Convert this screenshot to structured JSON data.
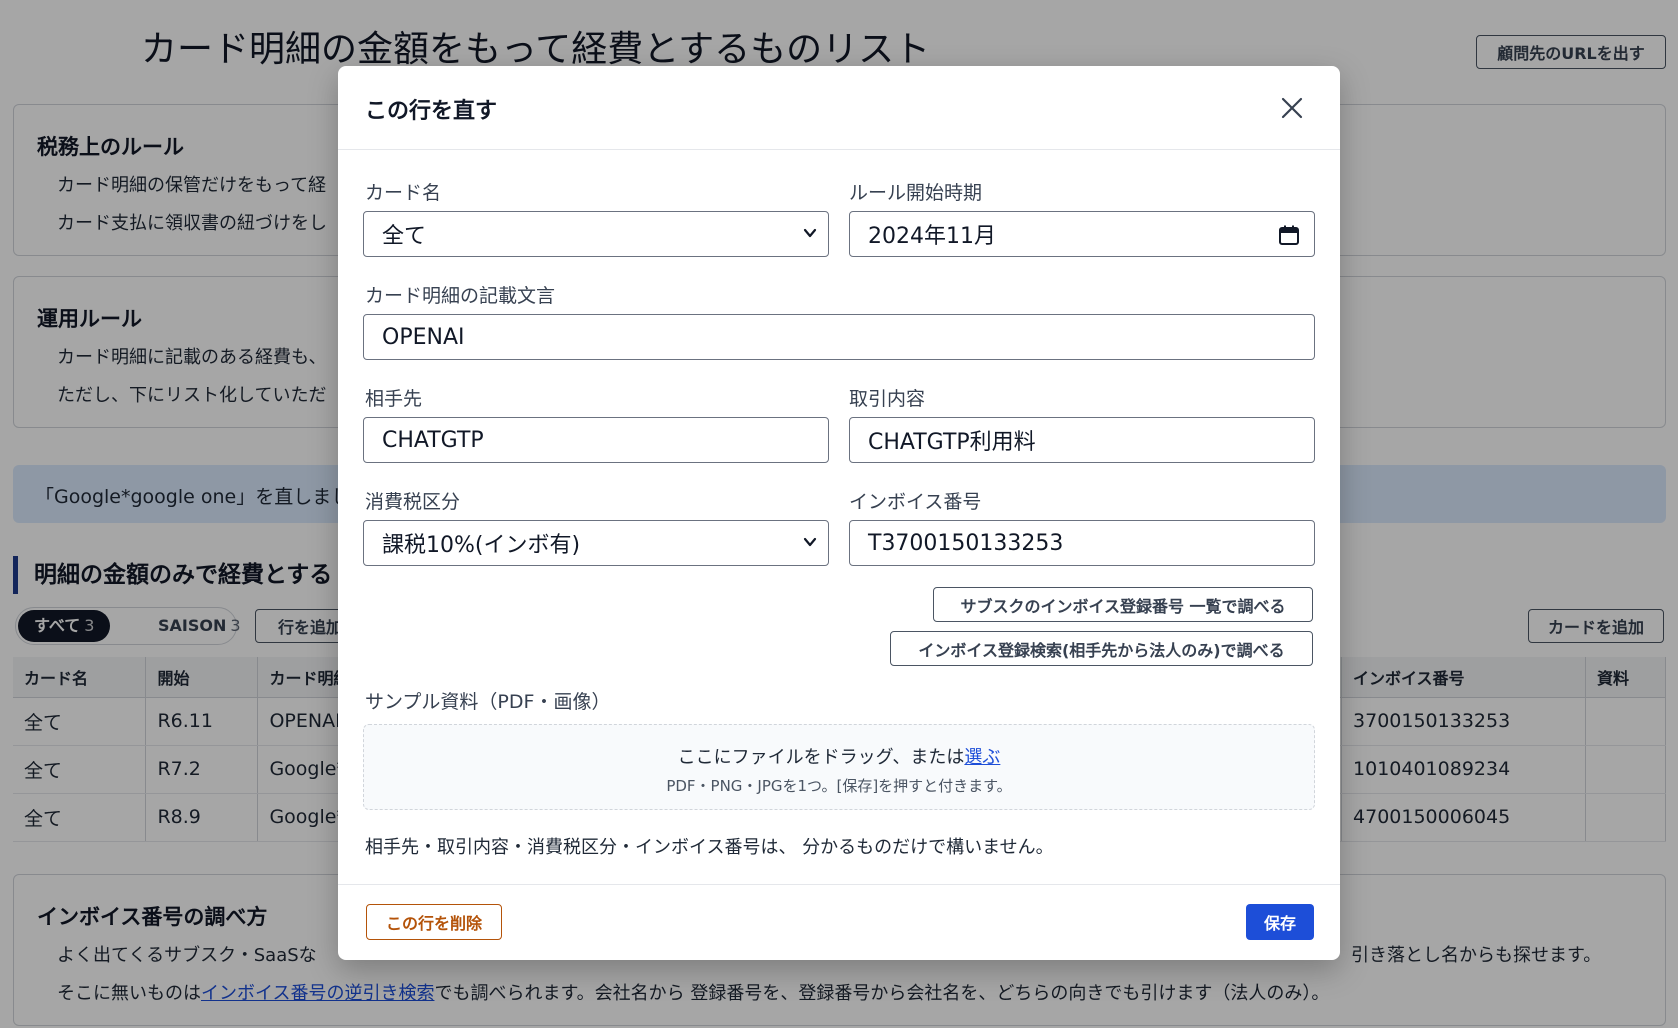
{
  "page": {
    "title": "カード明細の金額をもって経費とするものリスト",
    "share_button": "顧問先のURLを出す"
  },
  "tax_rules": {
    "heading": "税務上のルール",
    "line1": "カード明細の保管だけをもって経",
    "line2": "カード支払に領収書の紐づけをし"
  },
  "operation_rules": {
    "heading": "運用ルール",
    "line1": "カード明細に記載のある経費も、",
    "line2": "ただし、下にリスト化していただ"
  },
  "notice": "「Google*google one」を直しまし",
  "list": {
    "heading": "明細の金額のみで経費とする",
    "filters": [
      {
        "label": "すべて",
        "count": "3"
      },
      {
        "label": "SAISON",
        "count": "3"
      }
    ],
    "add_row_button": "行を追加",
    "add_card_button": "カードを追加",
    "columns": {
      "card": "カード名",
      "start": "開始",
      "text": "カード明細",
      "invoice": "インボイス番号",
      "file": "資料"
    },
    "rows": [
      {
        "card": "全て",
        "start": "R6.11",
        "text": "OPENAI",
        "invoice": "3700150133253",
        "file": ""
      },
      {
        "card": "全て",
        "start": "R7.2",
        "text": "Google*",
        "invoice": "1010401089234",
        "file": ""
      },
      {
        "card": "全て",
        "start": "R8.9",
        "text": "Google*",
        "invoice": "4700150006045",
        "file": ""
      }
    ]
  },
  "lookup": {
    "heading": "インボイス番号の調べ方",
    "line1_start": "よく出てくるサブスク・SaaSな",
    "line1_end": "引き落とし名からも探せます。",
    "line2_pre": "そこに無いものは",
    "line2_link": "インボイス番号の逆引き検索",
    "line2_post": "でも調べられます。会社名から 登録番号を、登録番号から会社名を、どちらの向きでも引けます（法人のみ）。"
  },
  "modal": {
    "title": "この行を直す",
    "card_name_label": "カード名",
    "card_name_value": "全て",
    "start_label": "ルール開始時期",
    "start_value": "2024年11月",
    "statement_label": "カード明細の記載文言",
    "statement_value": "OPENAI",
    "partner_label": "相手先",
    "partner_value": "CHATGTP",
    "content_label": "取引内容",
    "content_value": "CHATGTP利用料",
    "tax_label": "消費税区分",
    "tax_value": "課税10%(インボ有)",
    "invoice_label": "インボイス番号",
    "invoice_value": "T3700150133253",
    "lookup_list_button": "サブスクのインボイス登録番号 一覧で調べる",
    "lookup_search_button": "インボイス登録検索(相手先から法人のみ)で調べる",
    "sample_label": "サンプル資料（PDF・画像）",
    "drop_text": "ここにファイルをドラッグ、または",
    "drop_link": "選ぶ",
    "drop_hint": "PDF・PNG・JPGを1つ。[保存]を押すと付きます。",
    "note": "相手先・取引内容・消費税区分・インボイス番号は、 分かるものだけで構いません。",
    "delete_button": "この行を削除",
    "save_button": "保存"
  },
  "icons": {
    "close": "close-icon",
    "chevron": "chevron-down-icon",
    "calendar": "calendar-icon"
  },
  "colors": {
    "accent": "#1d4ed8",
    "danger": "#b45309",
    "notice_bg": "#dbeafe",
    "overlay": "rgba(0,0,0,0.35)"
  }
}
